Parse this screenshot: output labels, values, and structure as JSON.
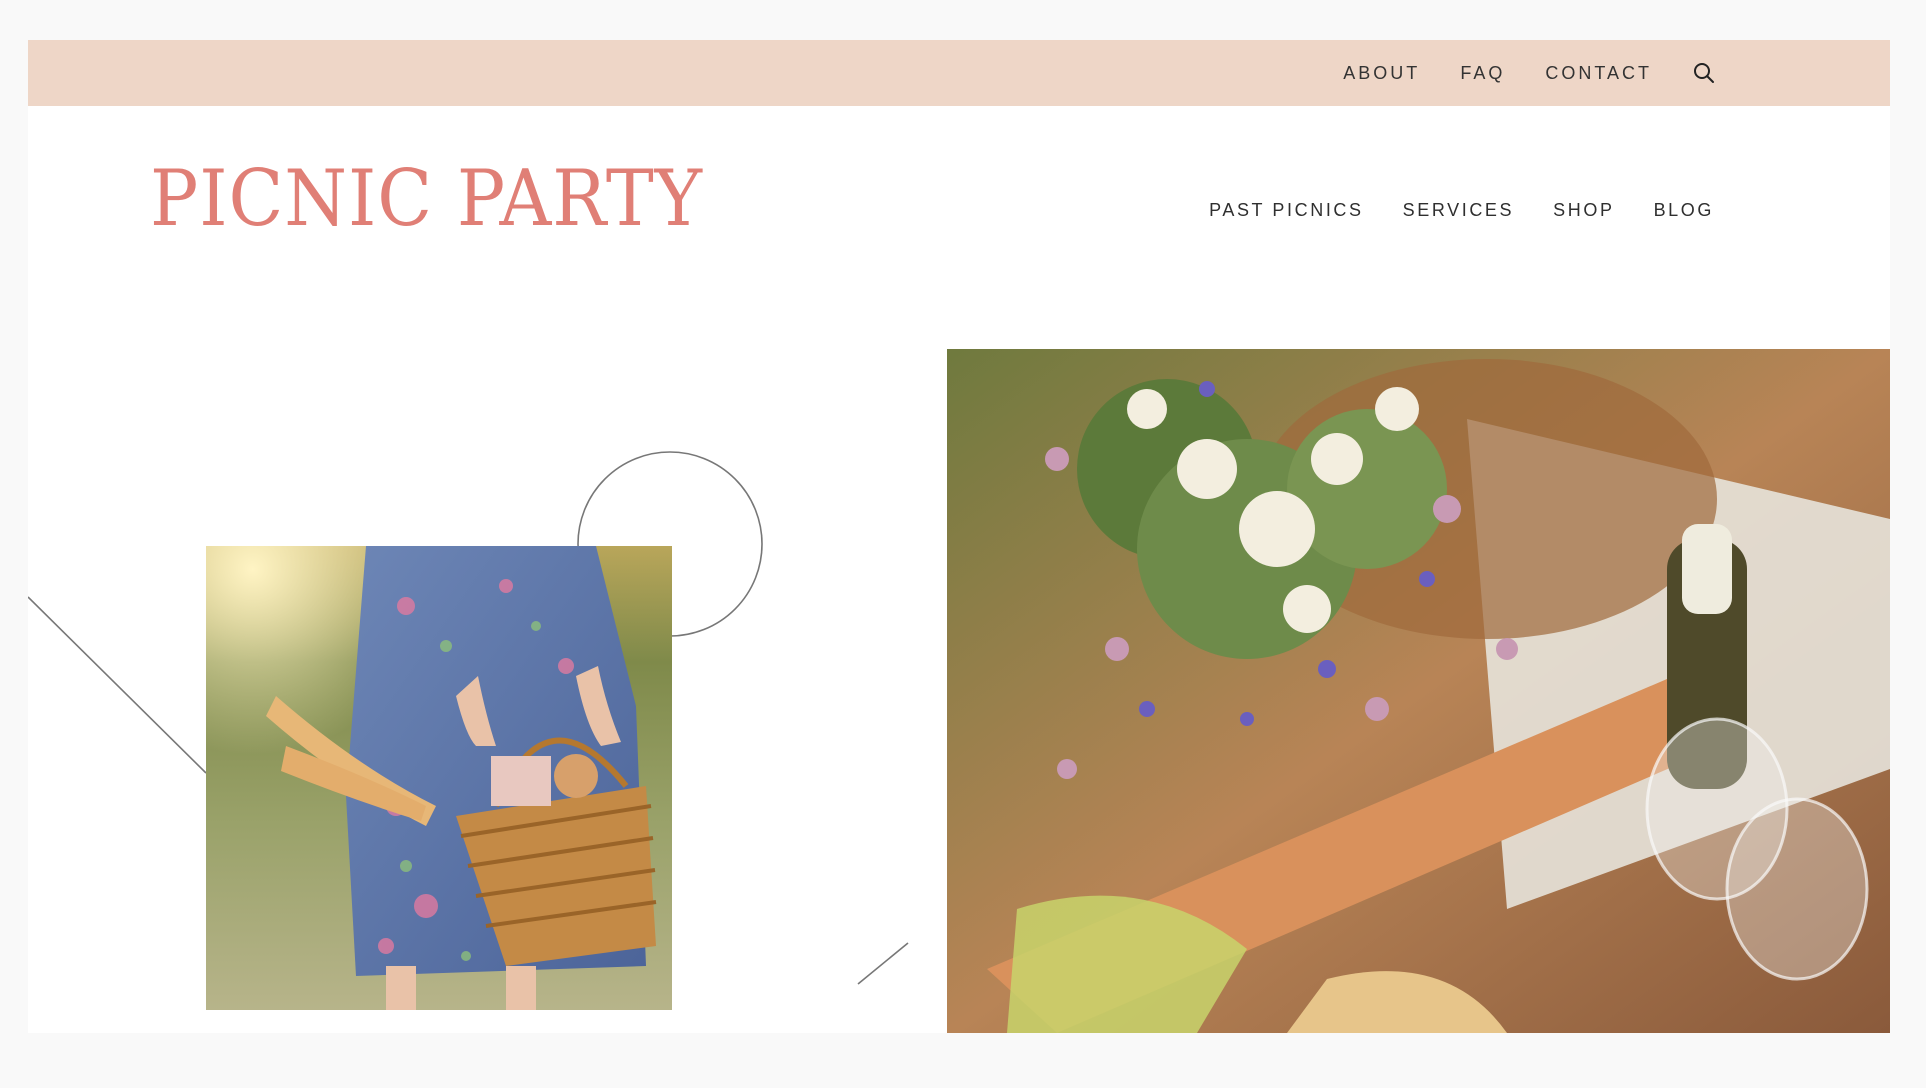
{
  "utility_nav": {
    "items": [
      {
        "label": "ABOUT"
      },
      {
        "label": "FAQ"
      },
      {
        "label": "CONTACT"
      }
    ],
    "search_icon": "search-icon"
  },
  "brand": {
    "logo_text": "PICNIC PARTY",
    "accent_color": "#e07f76",
    "topbar_color": "#eed6c7"
  },
  "main_nav": {
    "items": [
      {
        "label": "PAST PICNICS"
      },
      {
        "label": "SERVICES"
      },
      {
        "label": "SHOP"
      },
      {
        "label": "BLOG"
      }
    ]
  },
  "images": {
    "left": "picnic-basket-photo",
    "right": "wildflowers-picnic-photo"
  }
}
